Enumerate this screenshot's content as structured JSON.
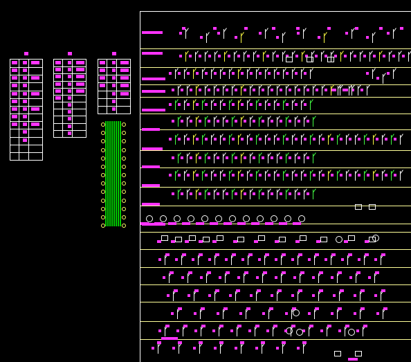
{
  "canvas": {
    "background": "#000000"
  },
  "colors": {
    "line": "#ffffff",
    "label": "#ff33ff",
    "green": "#44ff44",
    "yellow": "#ffff44",
    "rule": "#ffff99"
  },
  "tables": [
    {
      "name": "table-1",
      "rows": 13
    },
    {
      "name": "table-2",
      "rows": 11
    },
    {
      "name": "table-3",
      "rows": 7
    }
  ],
  "terminal": {
    "name": "terminal-strip",
    "terminals": 13
  },
  "panel": {
    "rows": 19
  }
}
